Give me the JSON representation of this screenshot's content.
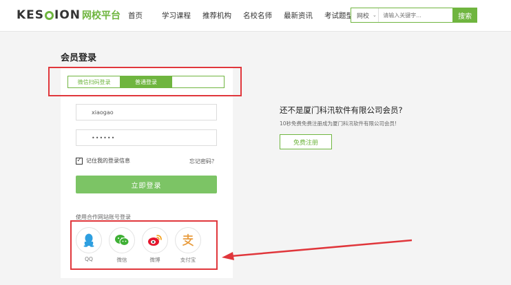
{
  "brand": {
    "name_part1": "KES",
    "name_part2": "ION",
    "sub": "网校平台"
  },
  "nav": {
    "items": [
      "首页",
      "学习课程",
      "推荐机构",
      "名校名师",
      "最新资讯",
      "考试题型"
    ]
  },
  "search": {
    "type": "网校",
    "placeholder": "请输入关键字...",
    "button": "搜索"
  },
  "login": {
    "title": "会员登录",
    "tabs": [
      "微信扫码登录",
      "普通登录"
    ],
    "username": "xiaogao",
    "password": "••••••",
    "remember": "记住我的登录信息",
    "forgot": "忘记密码？",
    "submit": "立即登录",
    "partner_label": "使用合作网站账号登录",
    "partners": [
      "QQ",
      "微信",
      "微博",
      "支付宝"
    ]
  },
  "promo": {
    "title": "还不是厦门科汛软件有限公司会员?",
    "subtitle": "10秒免费免费注册成为厦门科汛软件有限公司会员!",
    "register": "免费注册"
  },
  "colors": {
    "accent": "#6fb53f",
    "annotation": "#e0363b"
  }
}
